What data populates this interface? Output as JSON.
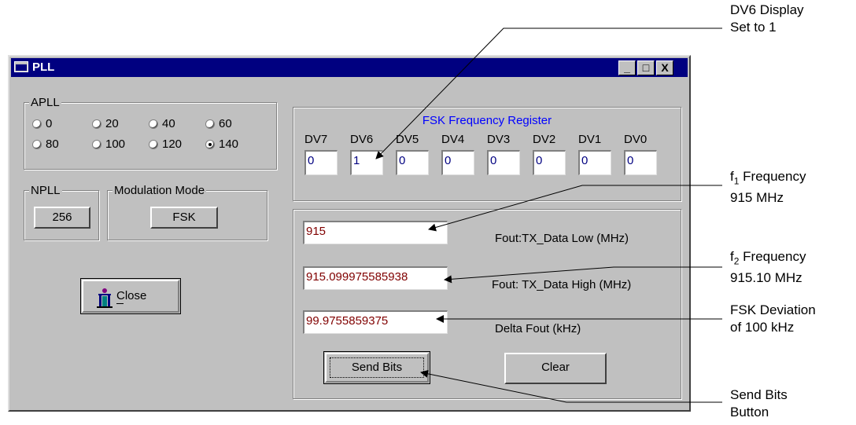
{
  "window": {
    "title": "PLL",
    "controls": {
      "minimize": "_",
      "maximize": "□",
      "close": "X"
    }
  },
  "apll": {
    "label": "APLL",
    "options": [
      "0",
      "20",
      "40",
      "60",
      "80",
      "100",
      "120",
      "140"
    ],
    "selected": "140"
  },
  "npll": {
    "label": "NPLL",
    "value": "256"
  },
  "modulation": {
    "label": "Modulation Mode",
    "value": "FSK"
  },
  "close_button": {
    "label": "Close",
    "mnemonic": "C"
  },
  "fsk_register": {
    "title": "FSK Frequency Register",
    "title_color": "#0000ff",
    "bits": [
      {
        "name": "DV7",
        "value": "0"
      },
      {
        "name": "DV6",
        "value": "1"
      },
      {
        "name": "DV5",
        "value": "0"
      },
      {
        "name": "DV4",
        "value": "0"
      },
      {
        "name": "DV3",
        "value": "0"
      },
      {
        "name": "DV2",
        "value": "0"
      },
      {
        "name": "DV1",
        "value": "0"
      },
      {
        "name": "DV0",
        "value": "0"
      }
    ]
  },
  "outputs": {
    "value_color": "#800000",
    "fout_low": {
      "value": "915",
      "label": "Fout:TX_Data Low (MHz)"
    },
    "fout_high": {
      "value": "915.099975585938",
      "label": "Fout: TX_Data High (MHz)"
    },
    "delta": {
      "value": "99.9755859375",
      "label": "Delta Fout (kHz)"
    }
  },
  "buttons": {
    "send_bits": "Send Bits",
    "clear": "Clear"
  },
  "annotations": {
    "dv6": [
      "DV6 Display",
      "Set to 1"
    ],
    "f1": {
      "prefix": "f",
      "sub": "1",
      "text": " Frequency",
      "line2": "915 MHz"
    },
    "f2": {
      "prefix": "f",
      "sub": "2",
      "text": " Frequency",
      "line2": "915.10 MHz"
    },
    "dev": [
      "FSK Deviation",
      "of 100 kHz"
    ],
    "send": [
      "Send Bits",
      "Button"
    ]
  }
}
